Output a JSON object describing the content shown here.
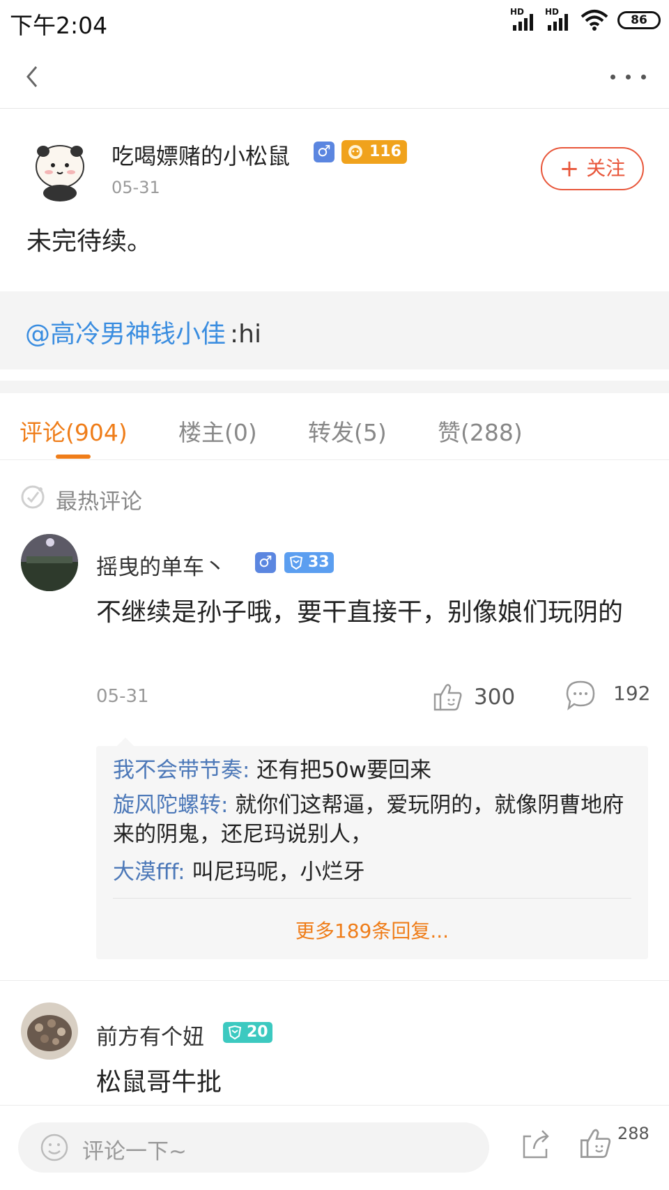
{
  "status_bar": {
    "time": "下午2:04",
    "signal1": "HD",
    "signal2": "HD",
    "battery": "86"
  },
  "post": {
    "author": "吃喝嫖赌的小松鼠",
    "gender": "♂",
    "level": "116",
    "date": "05-31",
    "follow_label": "关注",
    "follow_plus": "+",
    "text": "未完待续。",
    "repost": {
      "mention": "@高冷男神钱小佳",
      "text": ":hi"
    }
  },
  "tabs": [
    {
      "label": "评论(904)",
      "active": true
    },
    {
      "label": "楼主(0)"
    },
    {
      "label": "转发(5)"
    },
    {
      "label": "赞(288)"
    }
  ],
  "hot_comments_title": "最热评论",
  "comments": [
    {
      "name": "摇曳的单车丶",
      "gender": "♂",
      "level": "33",
      "text": "不继续是孙子哦，要干直接干，别像娘们玩阴的",
      "date": "05-31",
      "likes": "300",
      "reply_count": "192",
      "replies": [
        {
          "user": "我不会带节奏:",
          "text": " 还有把50w要回来"
        },
        {
          "user": "旋风陀螺转:",
          "text": " 就你们这帮逼，爱玩阴的，就像阴曹地府来的阴鬼，还尼玛说别人，"
        },
        {
          "user": "大漠fff:",
          "text": " 叫尼玛呢，小烂牙"
        }
      ],
      "more_replies": "更多189条回复..."
    },
    {
      "name": "前方有个妞",
      "level": "20",
      "text": "松鼠哥牛批"
    }
  ],
  "bottom_bar": {
    "placeholder": "评论一下~",
    "likes": "288"
  },
  "colors": {
    "accent": "#ef7d19",
    "follow": "#e8563a",
    "link": "#3a8de0",
    "reply_user": "#4c78b8",
    "gender": "#5b86e0"
  }
}
